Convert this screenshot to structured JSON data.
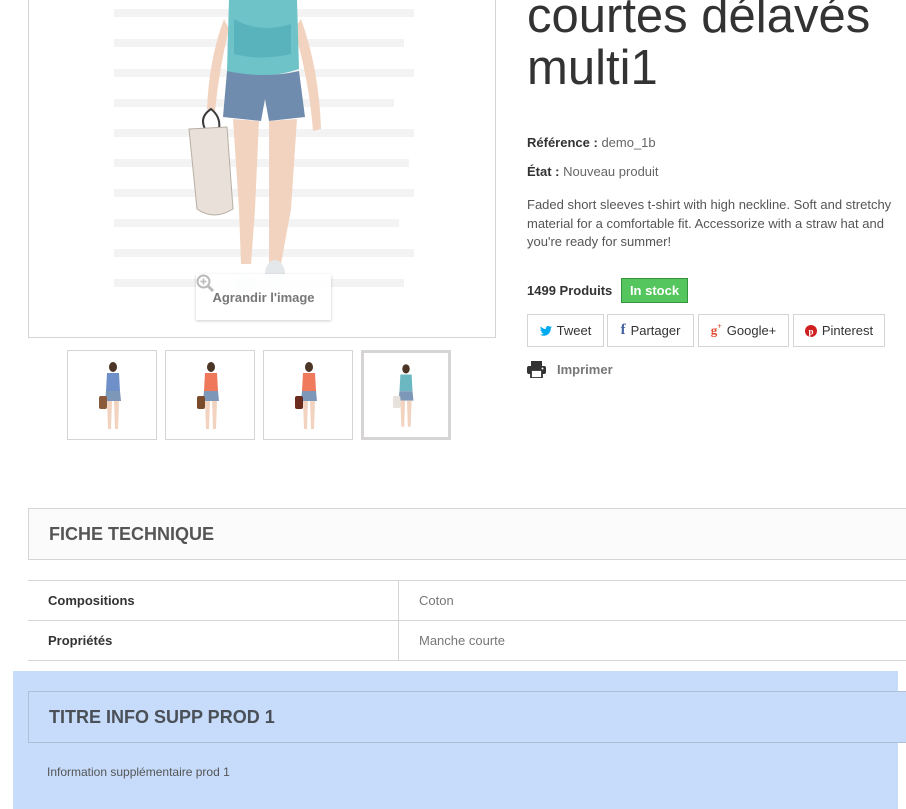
{
  "product": {
    "title_line1": "courtes délavés",
    "title_line2": "multi1",
    "reference_label": "Référence :",
    "reference_value": "demo_1b",
    "condition_label": "État :",
    "condition_value": "Nouveau produit",
    "description": "Faded short sleeves t-shirt with high neckline. Soft and stretchy material for a comfortable fit. Accessorize with a straw hat and you're ready for summer!",
    "quantity_text": "1499 Produits",
    "stock_status": "In stock"
  },
  "image": {
    "zoom_label": "Agrandir l'image",
    "thumbnails": [
      {
        "name": "thumb-1",
        "top_color": "#6f8fc9",
        "bag_color": "#8a5a3a",
        "active": false
      },
      {
        "name": "thumb-2",
        "top_color": "#f0785a",
        "bag_color": "#7b4a2a",
        "active": false
      },
      {
        "name": "thumb-3",
        "top_color": "#ef7a5c",
        "bag_color": "#6b2c1e",
        "active": false
      },
      {
        "name": "thumb-4",
        "top_color": "#6bb8c0",
        "bag_color": "#e8e2dc",
        "active": true
      }
    ]
  },
  "share": {
    "tweet": "Tweet",
    "facebook": "Partager",
    "google": "Google+",
    "pinterest": "Pinterest",
    "print": "Imprimer"
  },
  "datasheet": {
    "title": "FICHE TECHNIQUE",
    "rows": [
      {
        "key": "Compositions",
        "value": "Coton"
      },
      {
        "key": "Propriétés",
        "value": "Manche courte"
      }
    ]
  },
  "extra_info": {
    "title": "TITRE INFO SUPP PROD 1",
    "text": "Information supplémentaire prod 1"
  },
  "colors": {
    "stock_green": "#55c65e",
    "twitter_blue": "#00aaf0",
    "facebook_blue": "#435f9f",
    "google_red": "#e04b34",
    "pinterest_red": "#ce1f21",
    "highlight_blue": "#c6dcfa"
  }
}
